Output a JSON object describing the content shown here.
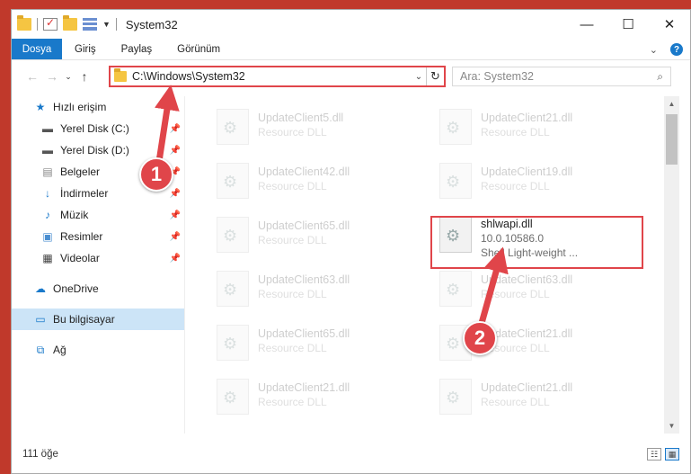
{
  "window": {
    "title": "System32",
    "controls": {
      "minimize": "—",
      "maximize": "☐",
      "close": "✕"
    }
  },
  "ribbon": {
    "tabs": [
      "Dosya",
      "Giriş",
      "Paylaş",
      "Görünüm"
    ],
    "expand_glyph": "⌄",
    "help_glyph": "?"
  },
  "nav": {
    "back": "←",
    "forward": "→",
    "recent": "⌄",
    "up": "↑",
    "address": "C:\\Windows\\System32",
    "search_placeholder": "Ara: System32"
  },
  "sidebar": {
    "quick_access": "Hızlı erişim",
    "items": [
      {
        "label": "Yerel Disk (C:)",
        "icon": "drive-icon"
      },
      {
        "label": "Yerel Disk (D:)",
        "icon": "drive-icon"
      },
      {
        "label": "Belgeler",
        "icon": "documents-icon"
      },
      {
        "label": "İndirmeler",
        "icon": "downloads-icon"
      },
      {
        "label": "Müzik",
        "icon": "music-icon"
      },
      {
        "label": "Resimler",
        "icon": "pictures-icon"
      },
      {
        "label": "Videolar",
        "icon": "videos-icon"
      }
    ],
    "onedrive": "OneDrive",
    "this_pc": "Bu bilgisayar",
    "network": "Ağ"
  },
  "files": {
    "left": [
      {
        "name": "UpdateClient5.dll",
        "sub": "Resource DLL"
      },
      {
        "name": "UpdateClient42.dll",
        "sub": "Resource DLL"
      },
      {
        "name": "UpdateClient65.dll",
        "sub": "Resource DLL"
      },
      {
        "name": "UpdateClient63.dll",
        "sub": "Resource DLL"
      },
      {
        "name": "UpdateClient65.dll",
        "sub": "Resource DLL"
      },
      {
        "name": "UpdateClient21.dll",
        "sub": "Resource DLL"
      }
    ],
    "right": [
      {
        "name": "UpdateClient21.dll",
        "sub": "Resource DLL"
      },
      {
        "name": "UpdateClient19.dll",
        "sub": "Resource DLL"
      },
      {
        "name": "shlwapi.dll",
        "sub": "10.0.10586.0",
        "sub2": "Shell Light-weight ..."
      },
      {
        "name": "UpdateClient63.dll",
        "sub": "Resource DLL"
      },
      {
        "name": "UpdateClient21.dll",
        "sub": "Resource DLL"
      },
      {
        "name": "UpdateClient21.dll",
        "sub": "Resource DLL"
      }
    ]
  },
  "status": {
    "count": "111 öğe"
  },
  "annotations": {
    "badge_1": "1",
    "badge_2": "2",
    "color": "#e0454a"
  },
  "colors": {
    "accent": "#1979ca",
    "selection": "#cce4f7",
    "highlight": "#e0454a"
  }
}
